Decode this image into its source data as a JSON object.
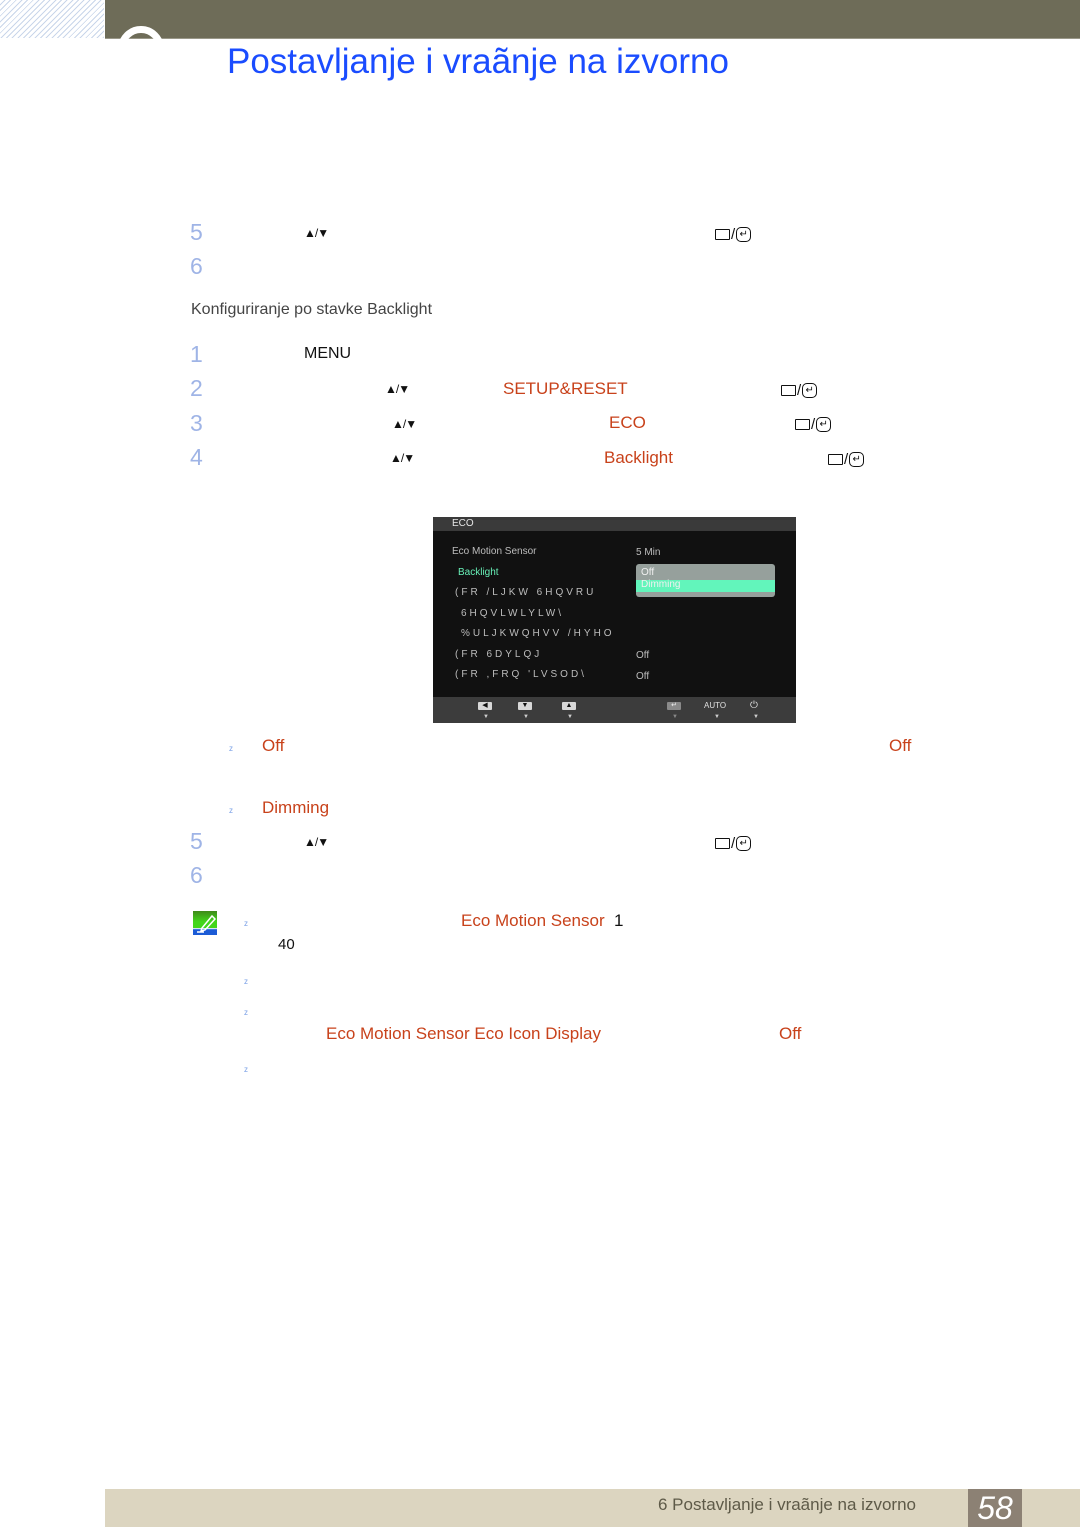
{
  "header": {
    "title": "Postavljanje i vraãnje na izvorno"
  },
  "icons": {
    "up_down": "▲/▼",
    "enter_slash": "/",
    "enter_glyph": "↵"
  },
  "section1": {
    "steps": [
      {
        "num": "5",
        "arrows": true,
        "button": true
      },
      {
        "num": "6"
      }
    ]
  },
  "section2": {
    "heading": "Konfiguriranje po stavke Backlight",
    "steps": [
      {
        "num": "1",
        "text": "MENU"
      },
      {
        "num": "2",
        "highlight": "SETUP&RESET"
      },
      {
        "num": "3",
        "highlight": "ECO"
      },
      {
        "num": "4",
        "highlight": "Backlight"
      }
    ]
  },
  "osd": {
    "header": "ECO",
    "items": [
      {
        "label": "Eco Motion Sensor",
        "value": "5 Min"
      },
      {
        "label": "Backlight",
        "selected": true
      },
      {
        "label": "(FR /LJKW 6HQVRU"
      },
      {
        "label": "6HQVLWLYLW\\"
      },
      {
        "label": "%ULJKWQHVV /HYHO"
      },
      {
        "label": "(FR 6DYLQJ",
        "value": "Off"
      },
      {
        "label": "(FR ,FRQ 'LVSOD\\",
        "value": "Off"
      }
    ],
    "dropdown": {
      "options": [
        "Off",
        "Dimming"
      ],
      "selected": "Dimming"
    },
    "footer": {
      "buttons": [
        "left-arrow",
        "down-arrow",
        "up-arrow",
        "enter",
        "AUTO",
        "power"
      ],
      "auto_label": "AUTO"
    }
  },
  "options": [
    {
      "bullet": "z",
      "label": "Off",
      "trailing": "Off"
    },
    {
      "bullet": "z",
      "label": "Dimming"
    }
  ],
  "section3": {
    "steps": [
      {
        "num": "5"
      },
      {
        "num": "6"
      }
    ]
  },
  "notes": {
    "items": [
      {
        "bullet": "z",
        "highlight": "Eco Motion Sensor",
        "suffix": "1",
        "line2": "40"
      },
      {
        "bullet": "z"
      },
      {
        "bullet": "z",
        "highlight": "Eco Motion Sensor Eco Icon Display",
        "trailing": "Off"
      },
      {
        "bullet": "z"
      }
    ]
  },
  "footer": {
    "text": "6 Postavljanje i vraãnje na izvorno",
    "page": "58"
  }
}
